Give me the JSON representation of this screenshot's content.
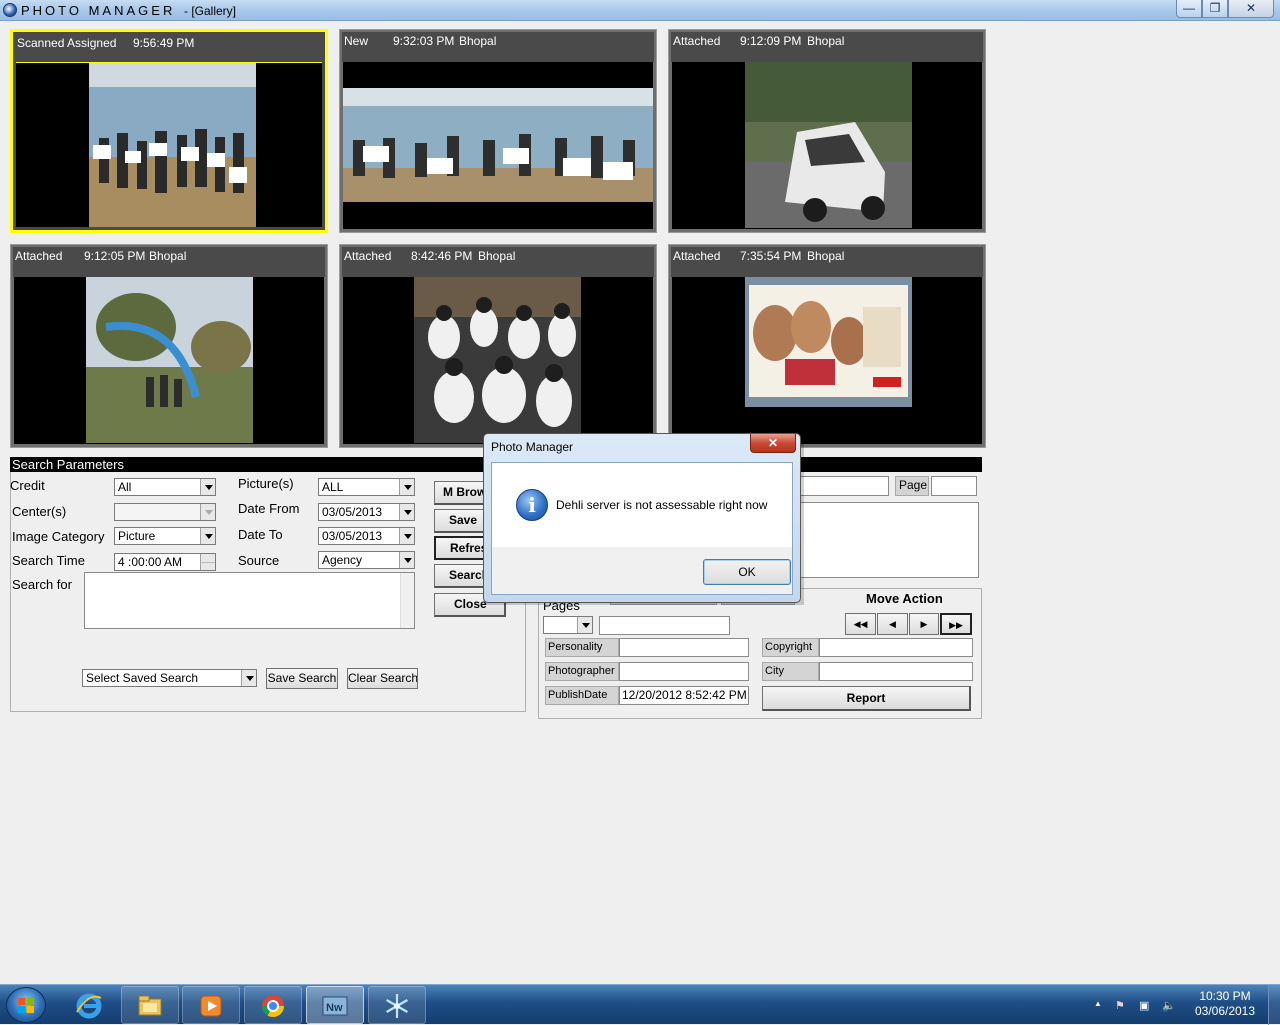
{
  "window": {
    "app_title": "PHOTO    MANAGER",
    "subtitle": "- [Gallery]",
    "min_glyph": "—",
    "max_glyph": "❐",
    "close_glyph": "✕"
  },
  "gallery": [
    {
      "status": "Scanned  Assigned",
      "time": "9:56:49 PM",
      "city": "",
      "selected": true
    },
    {
      "status": "New",
      "time": "9:32:03 PM",
      "city": "Bhopal",
      "selected": false
    },
    {
      "status": "Attached",
      "time": "9:12:09 PM",
      "city": "Bhopal",
      "selected": false
    },
    {
      "status": "Attached",
      "time": "9:12:05 PM",
      "city": "Bhopal",
      "selected": false
    },
    {
      "status": "Attached",
      "time": "8:42:46 PM",
      "city": "Bhopal",
      "selected": false
    },
    {
      "status": "Attached",
      "time": "7:35:54 PM",
      "city": "Bhopal",
      "selected": false
    }
  ],
  "search": {
    "header": "Search Parameters",
    "credit_label": "Credit",
    "credit_value": "All",
    "center_label": "Center(s)",
    "center_value": "",
    "image_category_label": "Image Category",
    "image_category_value": "Picture",
    "search_time_label": "Search Time",
    "search_time_value": "4 :00:00 AM",
    "search_for_label": "Search for",
    "pictures_label": "Picture(s)",
    "pictures_value": "ALL",
    "date_from_label": "Date From",
    "date_from_value": "03/05/2013",
    "date_to_label": "Date To",
    "date_to_value": "03/05/2013",
    "source_label": "Source",
    "source_value": "Agency",
    "saved_search_value": "Select Saved Search",
    "save_search_label": "Save Search",
    "clear_search_label": "Clear Search"
  },
  "side_buttons": {
    "browse": "M Brow",
    "save": "Save",
    "refresh": "Refres",
    "search": "Search",
    "close": "Close"
  },
  "details": {
    "page_label": "Page",
    "pages_label": "Pages",
    "personality_label": "Personality",
    "photographer_label": "Photographer",
    "publish_date_label": "PublishDate",
    "publish_date_value": "12/20/2012 8:52:42 PM",
    "copyright_label": "Copyright",
    "city_label": "City",
    "report_label": "Report",
    "move_action_label": "Move Action",
    "nav_first": "◀◀",
    "nav_prev": "◀",
    "nav_next": "▶",
    "nav_last": "▶▶"
  },
  "dialog": {
    "title": "Photo Manager",
    "message": "Dehli server is not assessable right now",
    "ok_label": "OK",
    "close_glyph": "✕",
    "icon_glyph": "i"
  },
  "taskbar": {
    "time": "10:30 PM",
    "date": "03/06/2013",
    "apps": [
      "internet-explorer",
      "file-explorer",
      "media-player",
      "chrome",
      "news-app",
      "snowflake-app"
    ],
    "tray_arrow": "▲",
    "tray_flag": "⚑",
    "tray_network": "▣",
    "tray_volume": "🔈"
  }
}
